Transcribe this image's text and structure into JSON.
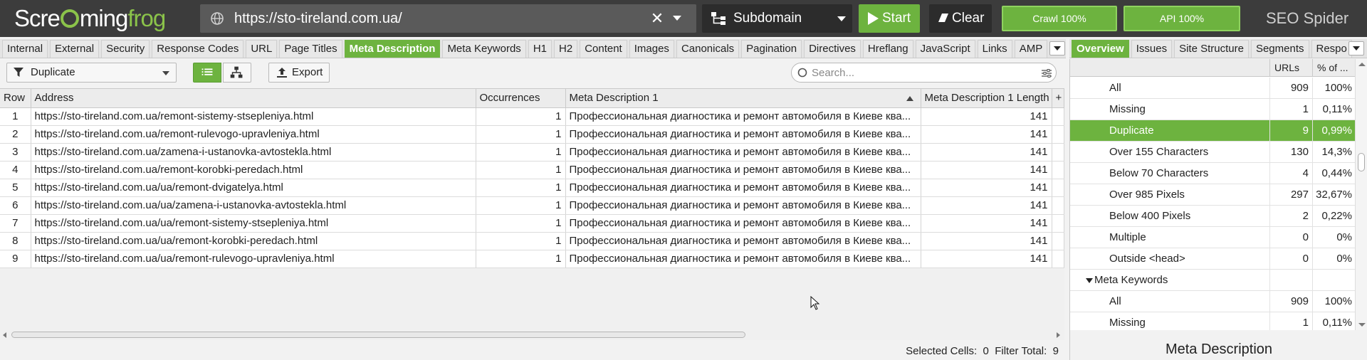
{
  "app": {
    "logo_text_a": "Scre",
    "logo_text_b": "ming",
    "logo_text_c": "frog",
    "brand": "SEO Spider"
  },
  "topbar": {
    "url": "https://sto-tireland.com.ua/",
    "mode": "Subdomain",
    "start_label": "Start",
    "clear_label": "Clear",
    "crawl_label": "Crawl 100%",
    "api_label": "API 100%"
  },
  "main_tabs": [
    "Internal",
    "External",
    "Security",
    "Response Codes",
    "URL",
    "Page Titles",
    "Meta Description",
    "Meta Keywords",
    "H1",
    "H2",
    "Content",
    "Images",
    "Canonicals",
    "Pagination",
    "Directives",
    "Hreflang",
    "JavaScript",
    "Links",
    "AMP"
  ],
  "main_active_tab": "Meta Description",
  "right_tabs": [
    "Overview",
    "Issues",
    "Site Structure",
    "Segments",
    "Respo"
  ],
  "right_active_tab": "Overview",
  "toolbar": {
    "filter_value": "Duplicate",
    "export_label": "Export",
    "search_placeholder": "Search..."
  },
  "table": {
    "columns": [
      "Row",
      "Address",
      "Occurrences",
      "Meta Description 1",
      "Meta Description 1 Length",
      "+"
    ],
    "rows": [
      {
        "row": "1",
        "address": "https://sto-tireland.com.ua/remont-sistemy-stsepleniya.html",
        "occurrences": "1",
        "meta": "Профессиональная диагностика и ремонт автомобиля в Киеве ква...",
        "length": "141"
      },
      {
        "row": "2",
        "address": "https://sto-tireland.com.ua/remont-rulevogo-upravleniya.html",
        "occurrences": "1",
        "meta": "Профессиональная диагностика и ремонт автомобиля в Киеве ква...",
        "length": "141"
      },
      {
        "row": "3",
        "address": "https://sto-tireland.com.ua/zamena-i-ustanovka-avtostekla.html",
        "occurrences": "1",
        "meta": "Профессиональная диагностика и ремонт автомобиля в Киеве ква...",
        "length": "141"
      },
      {
        "row": "4",
        "address": "https://sto-tireland.com.ua/remont-korobki-peredach.html",
        "occurrences": "1",
        "meta": "Профессиональная диагностика и ремонт автомобиля в Киеве ква...",
        "length": "141"
      },
      {
        "row": "5",
        "address": "https://sto-tireland.com.ua/ua/remont-dvigatelya.html",
        "occurrences": "1",
        "meta": "Профессиональная диагностика и ремонт автомобиля в Киеве ква...",
        "length": "141"
      },
      {
        "row": "6",
        "address": "https://sto-tireland.com.ua/ua/zamena-i-ustanovka-avtostekla.html",
        "occurrences": "1",
        "meta": "Профессиональная диагностика и ремонт автомобиля в Киеве ква...",
        "length": "141"
      },
      {
        "row": "7",
        "address": "https://sto-tireland.com.ua/ua/remont-sistemy-stsepleniya.html",
        "occurrences": "1",
        "meta": "Профессиональная диагностика и ремонт автомобиля в Киеве ква...",
        "length": "141"
      },
      {
        "row": "8",
        "address": "https://sto-tireland.com.ua/ua/remont-korobki-peredach.html",
        "occurrences": "1",
        "meta": "Профессиональная диагностика и ремонт автомобиля в Киеве ква...",
        "length": "141"
      },
      {
        "row": "9",
        "address": "https://sto-tireland.com.ua/ua/remont-rulevogo-upravleniya.html",
        "occurrences": "1",
        "meta": "Профессиональная диагностика и ремонт автомобиля в Киеве ква...",
        "length": "141"
      }
    ]
  },
  "status": {
    "selected_label": "Selected Cells:",
    "selected_value": "0",
    "filter_label": "Filter Total:",
    "filter_value": "9"
  },
  "overview": {
    "col_urls": "URLs",
    "col_pct": "% of ...",
    "rows": [
      {
        "label": "All",
        "urls": "909",
        "pct": "100%"
      },
      {
        "label": "Missing",
        "urls": "1",
        "pct": "0,11%"
      },
      {
        "label": "Duplicate",
        "urls": "9",
        "pct": "0,99%"
      },
      {
        "label": "Over 155 Characters",
        "urls": "130",
        "pct": "14,3%"
      },
      {
        "label": "Below 70 Characters",
        "urls": "4",
        "pct": "0,44%"
      },
      {
        "label": "Over 985 Pixels",
        "urls": "297",
        "pct": "32,67%"
      },
      {
        "label": "Below 400 Pixels",
        "urls": "2",
        "pct": "0,22%"
      },
      {
        "label": "Multiple",
        "urls": "0",
        "pct": "0%"
      },
      {
        "label": "Outside <head>",
        "urls": "0",
        "pct": "0%"
      }
    ],
    "group_label": "Meta Keywords",
    "group_rows": [
      {
        "label": "All",
        "urls": "909",
        "pct": "100%"
      },
      {
        "label": "Missing",
        "urls": "1",
        "pct": "0,11%"
      }
    ],
    "footer_title": "Meta Description"
  },
  "colors": {
    "accent": "#6db33f",
    "topbar": "#3c3c3c"
  }
}
